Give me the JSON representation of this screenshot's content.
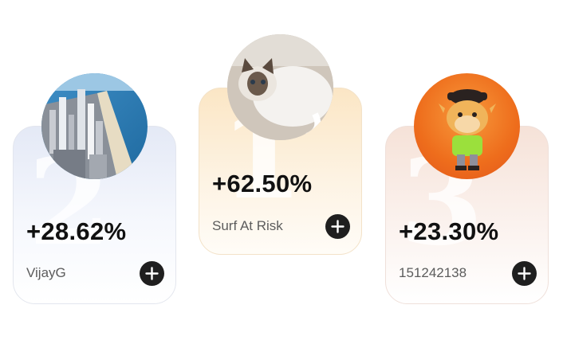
{
  "leaderboard": [
    {
      "rank": "1",
      "change": "+62.50%",
      "name": "Surf At Risk",
      "avatar": "cat-photo"
    },
    {
      "rank": "2",
      "change": "+28.62%",
      "name": "VijayG",
      "avatar": "city-skyline-photo"
    },
    {
      "rank": "3",
      "change": "+23.30%",
      "name": "151242138",
      "avatar": "bull-mascot-figure"
    }
  ],
  "colors": {
    "first_place": "#fbe6c5",
    "second_place": "#e4e9f6",
    "third_place": "#f6e2d8",
    "add_button": "#1f1f1f"
  },
  "icons": {
    "add": "plus-circle-icon"
  }
}
